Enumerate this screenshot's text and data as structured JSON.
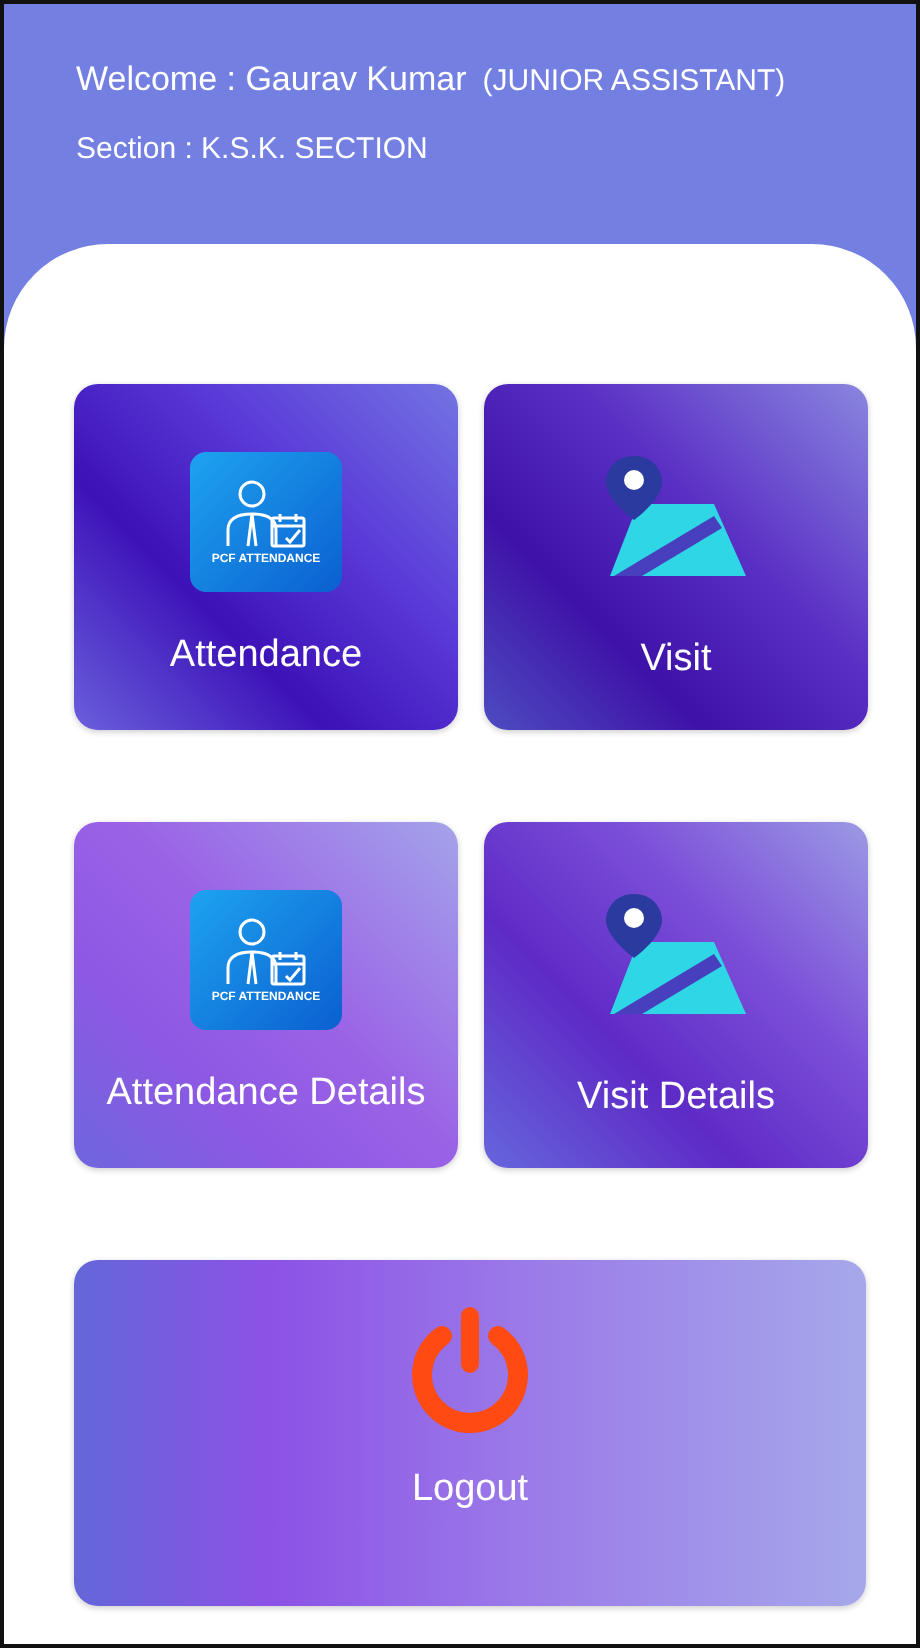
{
  "header": {
    "welcome": "Welcome : Gaurav Kumar",
    "role": "(JUNIOR ASSISTANT)",
    "section": "Section : K.S.K. SECTION"
  },
  "tiles": [
    {
      "label": "Attendance",
      "kind": "attendance",
      "badge": "PCF ATTENDANCE"
    },
    {
      "label": "Visit",
      "kind": "map"
    },
    {
      "label": "Attendance Details",
      "kind": "attendance",
      "badge": "PCF ATTENDANCE"
    },
    {
      "label": "Visit Details",
      "kind": "map"
    }
  ],
  "logout": {
    "label": "Logout"
  }
}
